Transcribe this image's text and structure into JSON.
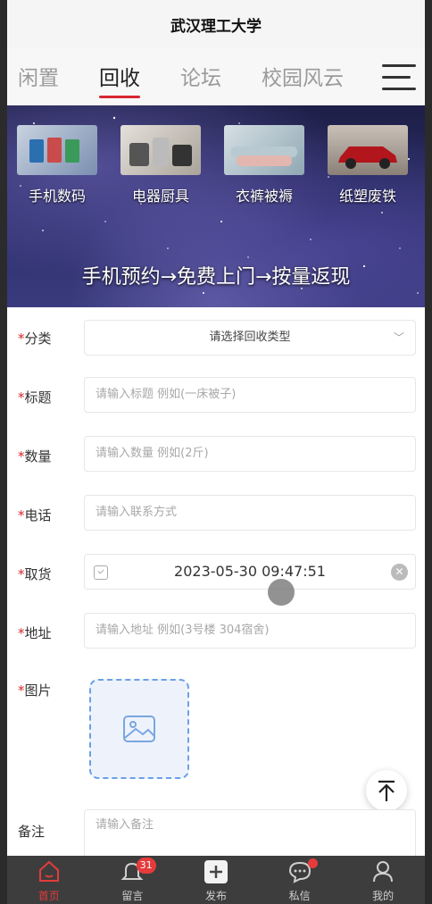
{
  "header": {
    "title": "武汉理工大学"
  },
  "tabs": [
    "闲置",
    "回收",
    "论坛",
    "校园风云"
  ],
  "active_tab": "回收",
  "banner": {
    "categories": [
      "手机数码",
      "电器厨具",
      "衣裤被褥",
      "纸塑废铁"
    ],
    "slogan": "手机预约→免费上门→按量返现"
  },
  "form": {
    "category": {
      "label": "分类",
      "placeholder": "请选择回收类型"
    },
    "title": {
      "label": "标题",
      "placeholder": "请输入标题 例如(一床被子)"
    },
    "quantity": {
      "label": "数量",
      "placeholder": "请输入数量 例如(2斤)"
    },
    "phone": {
      "label": "电话",
      "placeholder": "请输入联系方式"
    },
    "pickup": {
      "label": "取货",
      "value": "2023-05-30 09:47:51"
    },
    "address": {
      "label": "地址",
      "placeholder": "请输入地址 例如(3号楼 304宿舍)"
    },
    "images": {
      "label": "图片"
    },
    "notes": {
      "label": "备注",
      "placeholder": "请输入备注"
    },
    "required_mark": "*"
  },
  "tabbar": {
    "items": [
      "首页",
      "留言",
      "发布",
      "私信",
      "我的"
    ],
    "message_badge": "31"
  },
  "colors": {
    "accent": "#d8262f",
    "tabbar_bg": "#3d3d3d"
  }
}
